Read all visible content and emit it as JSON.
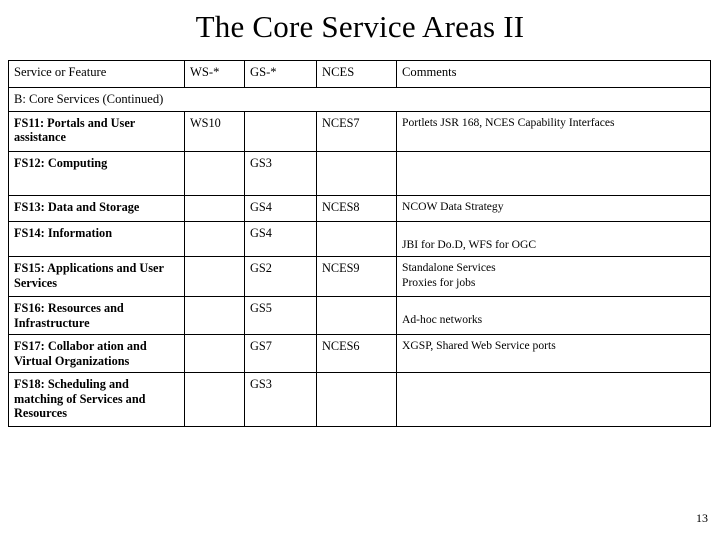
{
  "slide": {
    "title": "The Core Service Areas II",
    "page_number": "13"
  },
  "table": {
    "headers": [
      "Service or Feature",
      "WS-*",
      "GS-*",
      "NCES",
      "Comments"
    ],
    "section_label": "B: Core Services (Continued)",
    "rows": [
      {
        "feature_line1": "FS11: Portals and User",
        "feature_line2": "assistance",
        "ws": "WS10",
        "gs": "",
        "nces": "NCES7",
        "comments_line1": "Portlets JSR 168, NCES Capability Interfaces",
        "comments_line2": ""
      },
      {
        "feature_line1": "FS12: Computing",
        "feature_line2": "",
        "ws": "",
        "gs": "GS3",
        "nces": "",
        "comments_line1": "",
        "comments_line2": ""
      },
      {
        "feature_line1": "FS13: Data and  Storage",
        "feature_line2": "",
        "ws": "",
        "gs": "GS4",
        "nces": "NCES8",
        "comments_line1": "NCOW Data Strategy",
        "comments_line2": ""
      },
      {
        "feature_line1": "FS14: Information",
        "feature_line2": "",
        "ws": "",
        "gs": "GS4",
        "nces": "",
        "comments_line1": "JBI for Do.D, WFS for OGC",
        "comments_line2": ""
      },
      {
        "feature_line1": "FS15: Applications and User",
        "feature_line2": "Services",
        "ws": "",
        "gs": "GS2",
        "nces": "NCES9",
        "comments_line1": "Standalone  Services",
        "comments_line2": "Proxies for jobs"
      },
      {
        "feature_line1": "FS16: Resources and",
        "feature_line2": "Infrastructure",
        "ws": "",
        "gs": "GS5",
        "nces": "",
        "comments_line1": "Ad-hoc networks",
        "comments_line2": ""
      },
      {
        "feature_line1": "FS17: Collabor ation and",
        "feature_line2": "Virtual Organizations",
        "ws": "",
        "gs": "GS7",
        "nces": "NCES6",
        "comments_line1": "XGSP, Shared Web Service ports",
        "comments_line2": ""
      },
      {
        "feature_line1": "FS18: Scheduling and",
        "feature_line2": "matching of Services and",
        "feature_line3": "Resources",
        "ws": "",
        "gs": "GS3",
        "nces": "",
        "comments_line1": "",
        "comments_line2": ""
      }
    ]
  }
}
